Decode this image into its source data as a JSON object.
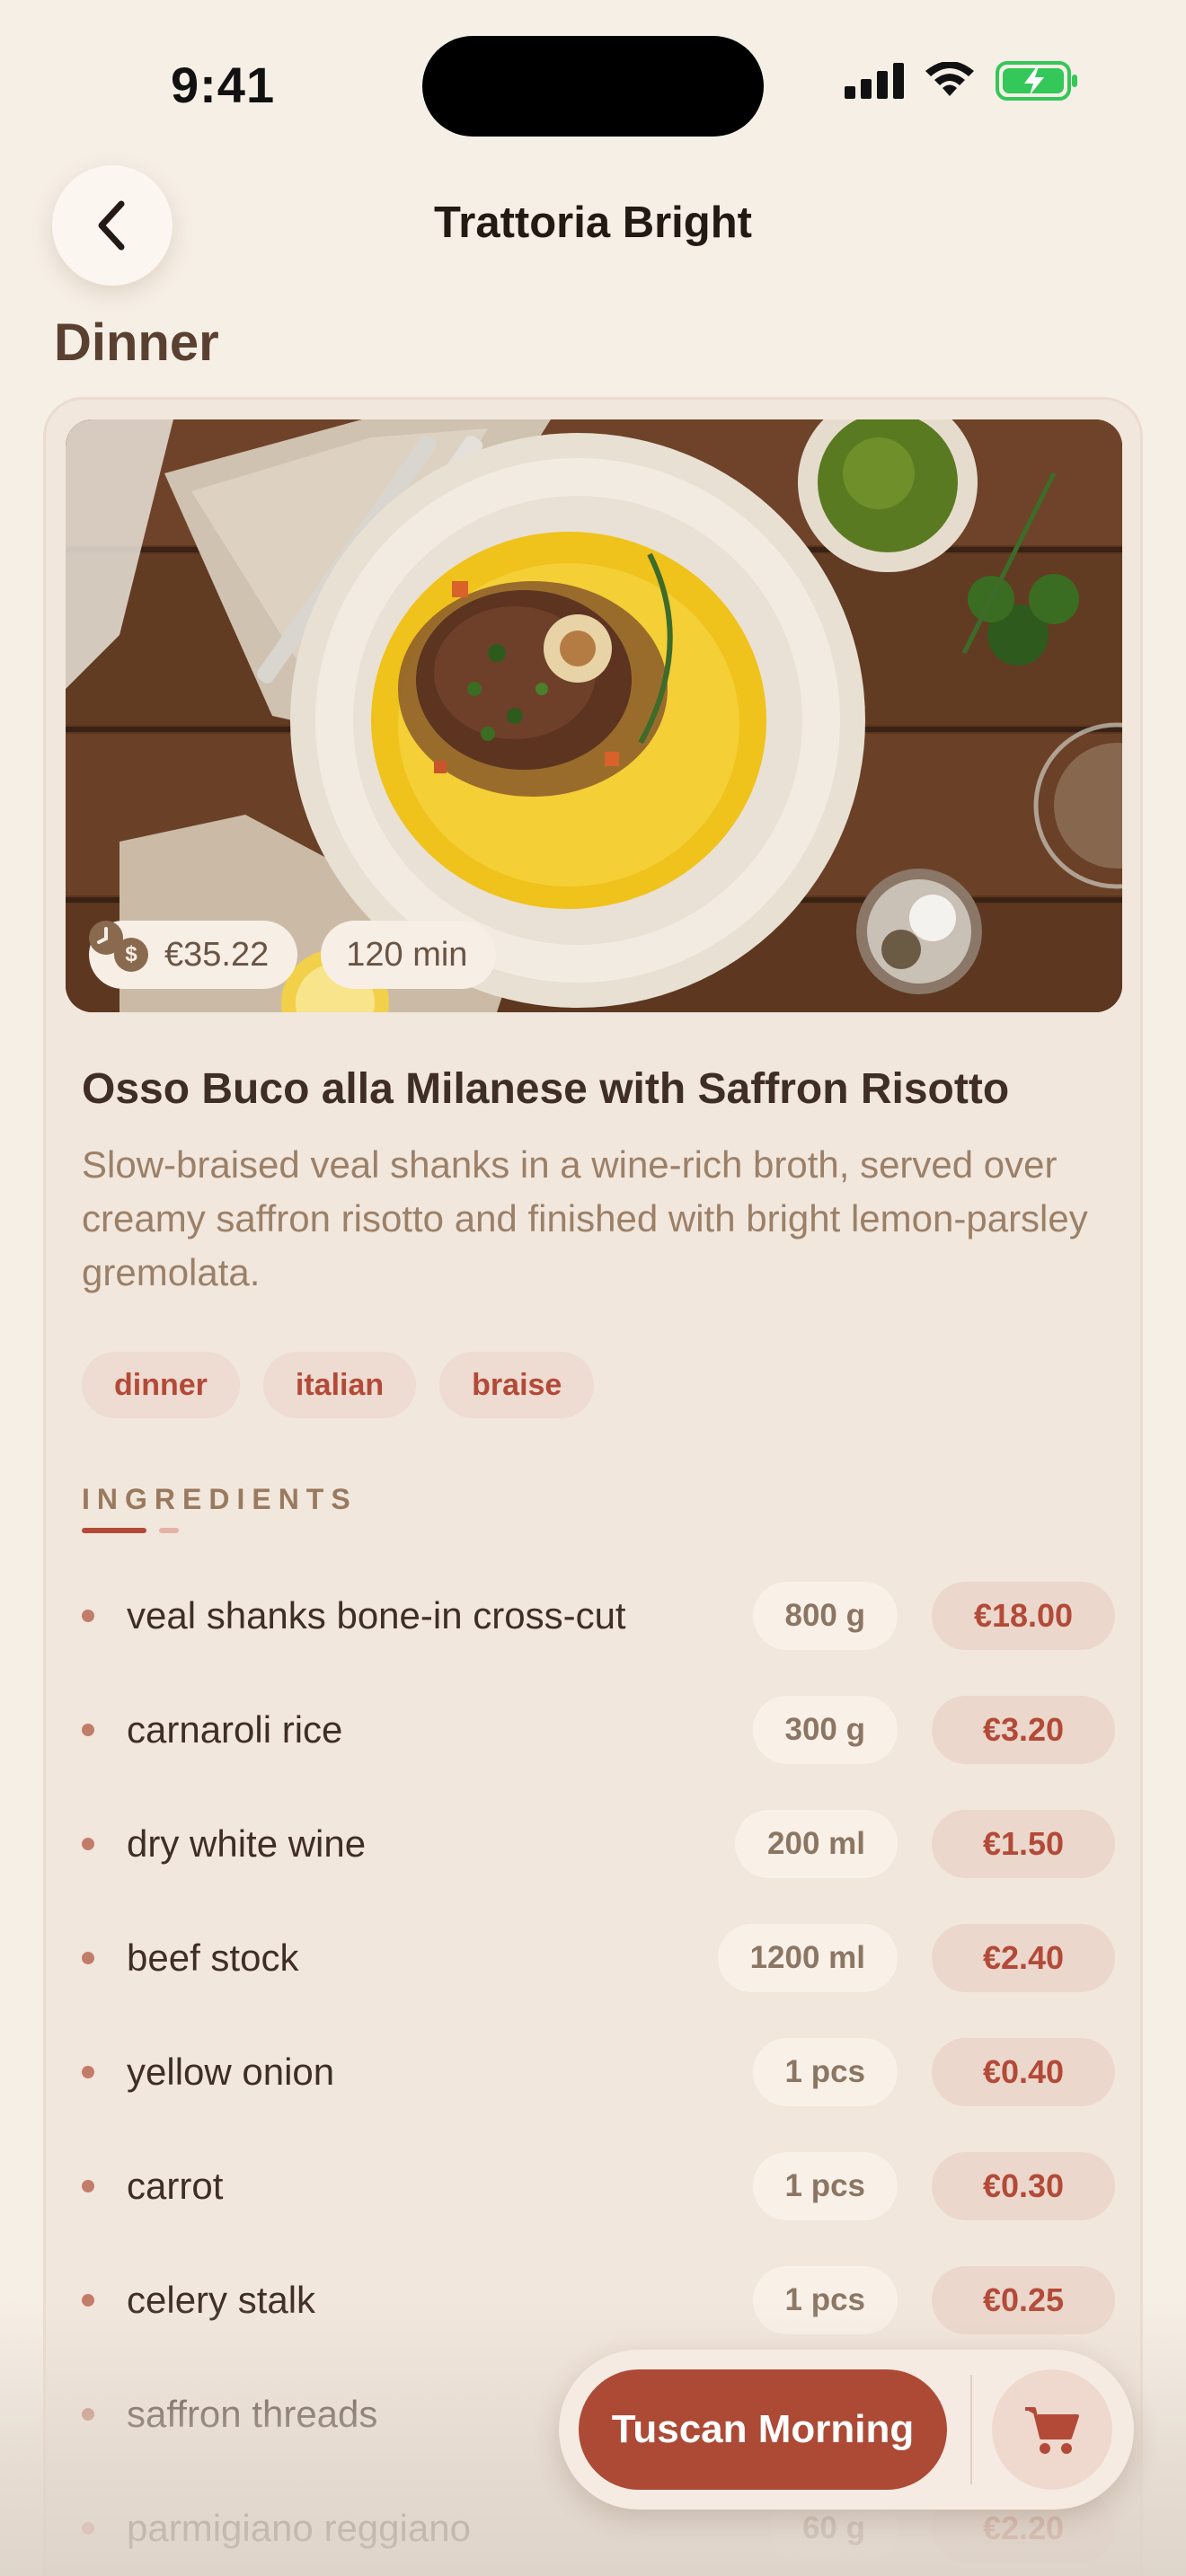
{
  "status_bar": {
    "time": "9:41"
  },
  "header": {
    "title": "Trattoria Bright",
    "back_icon": "chevron-left-icon"
  },
  "section": {
    "title": "Dinner"
  },
  "dish": {
    "image_desc": "osso buco with saffron risotto",
    "price": "€35.22",
    "time": "120 min",
    "price_icon": "dollar-coin-icon",
    "time_icon": "clock-icon",
    "title": "Osso Buco alla Milanese with Saffron Risotto",
    "description": "Slow-braised veal shanks in a wine-rich broth, served over creamy saffron risotto and finished with bright lemon-parsley gremolata.",
    "tags": [
      "dinner",
      "italian",
      "braise"
    ]
  },
  "ingredients": {
    "heading": "INGREDIENTS",
    "items": [
      {
        "name": "veal shanks bone-in cross-cut",
        "qty": "800 g",
        "price": "€18.00"
      },
      {
        "name": "carnaroli rice",
        "qty": "300 g",
        "price": "€3.20"
      },
      {
        "name": "dry white wine",
        "qty": "200 ml",
        "price": "€1.50"
      },
      {
        "name": "beef stock",
        "qty": "1200 ml",
        "price": "€2.40"
      },
      {
        "name": "yellow onion",
        "qty": "1 pcs",
        "price": "€0.40"
      },
      {
        "name": "carrot",
        "qty": "1 pcs",
        "price": "€0.30"
      },
      {
        "name": "celery stalk",
        "qty": "1 pcs",
        "price": "€0.25"
      },
      {
        "name": "saffron threads",
        "qty": "",
        "price": ""
      },
      {
        "name": "parmigiano reggiano",
        "qty": "60 g",
        "price": "€2.20"
      }
    ]
  },
  "footer": {
    "cta_label": "Tuscan Morning",
    "cart_icon": "cart-icon"
  },
  "colors": {
    "accent": "#ad4a36",
    "background": "#f6efe6",
    "card": "#f2e7dd"
  }
}
